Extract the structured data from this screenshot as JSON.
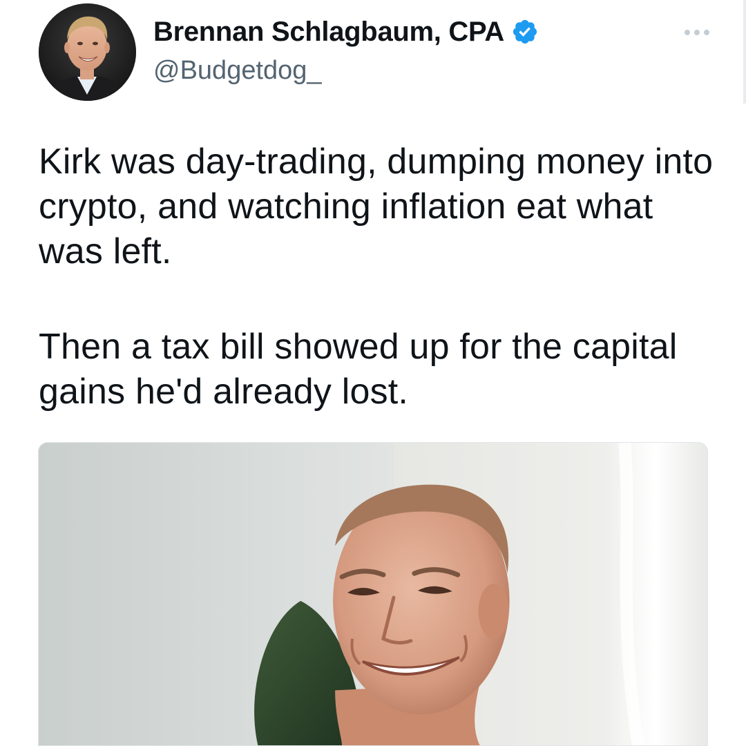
{
  "author": {
    "display_name": "Brennan Schlagbaum, CPA",
    "handle": "@Budgetdog_",
    "verified": true,
    "avatar_icon": "profile-photo"
  },
  "tweet": {
    "paragraphs": [
      "Kirk was day-trading, dumping money into crypto, and watching inflation eat what was left.",
      "Then a tax bill showed up for the capital gains he'd already lost."
    ]
  },
  "media": {
    "kind": "photo",
    "subject_icon": "smiling-man-photo"
  },
  "icons": {
    "verified": "verified-badge-icon",
    "more": "more-options-icon"
  },
  "colors": {
    "verified_blue": "#1d9bf0",
    "text_primary": "#0f1419",
    "text_secondary": "#536471",
    "more_dots": "#c4cdd3"
  }
}
